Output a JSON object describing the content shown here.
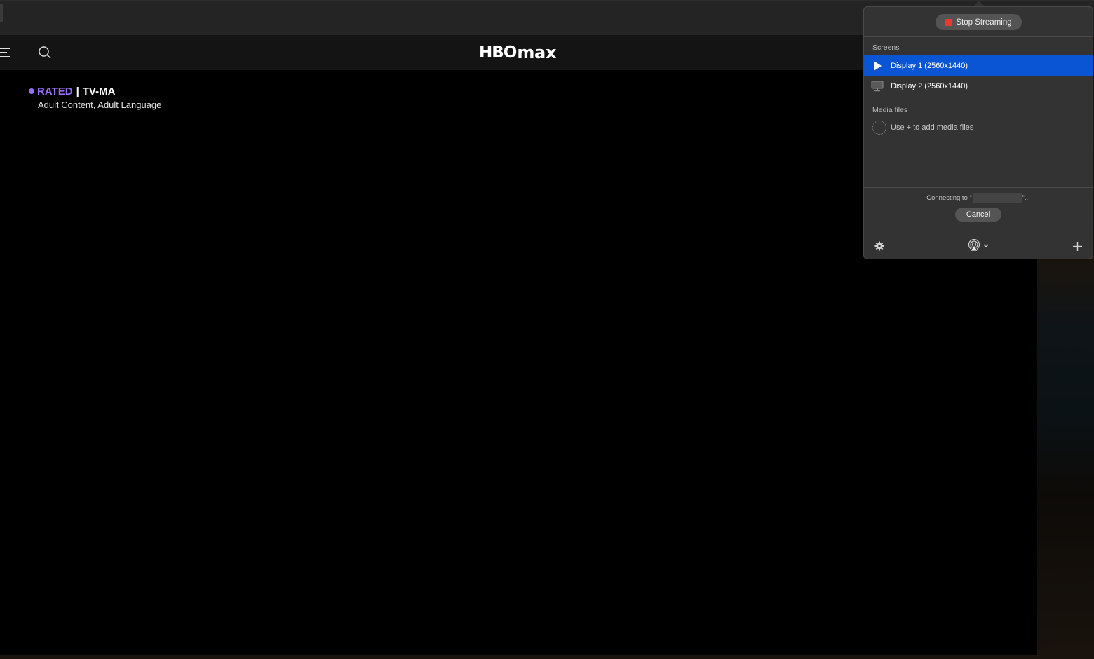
{
  "browser": {
    "brand": {
      "hbo": "HBO",
      "max": "max"
    },
    "nav": {
      "menu_icon": "menu-icon",
      "search_icon": "search-icon"
    },
    "rating": {
      "label": "RATED",
      "separator": "|",
      "value": "TV-MA",
      "descriptors": "Adult Content, Adult Language",
      "accent_color": "#9a6cf0"
    }
  },
  "airplay_panel": {
    "stop_button": {
      "label": "Stop Streaming",
      "icon": "stop-square-icon",
      "icon_color": "#e83a30"
    },
    "screens": {
      "heading": "Screens",
      "items": [
        {
          "label": "Display 1 (2560x1440)",
          "icon": "play-icon",
          "selected": true
        },
        {
          "label": "Display 2 (2560x1440)",
          "icon": "monitor-icon",
          "selected": false
        }
      ]
    },
    "media_files": {
      "heading": "Media files",
      "empty_text": "Use + to add media files"
    },
    "status": {
      "prefix": "Connecting to “",
      "suffix": "”..."
    },
    "cancel_button": {
      "label": "Cancel"
    },
    "footer": {
      "settings_icon": "gear-icon",
      "airplay_icon": "airplay-audio-icon",
      "add_icon": "plus-icon"
    },
    "selected_color": "#0a55d3"
  }
}
